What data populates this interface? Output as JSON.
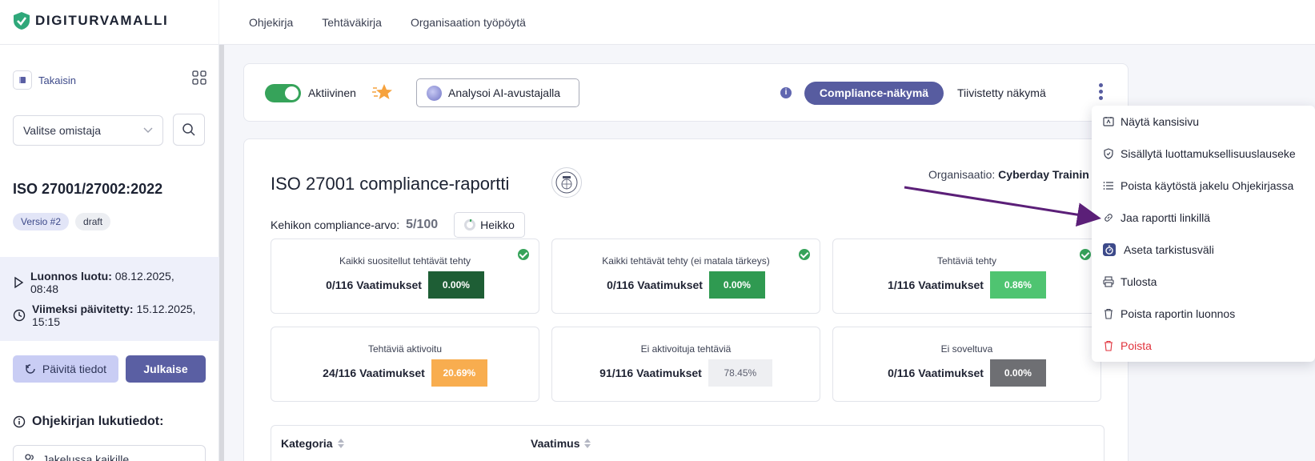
{
  "brand": {
    "name": "DIGITURVAMALLI"
  },
  "topnav": [
    "Ohjekirja",
    "Tehtäväkirja",
    "Organisaation työpöytä"
  ],
  "sidebar": {
    "back_label": "Takaisin",
    "owner_select": "Valitse omistaja",
    "doc_title": "ISO 27001/27002:2022",
    "version_badge": "Versio #2",
    "status_badge": "draft",
    "created_label": "Luonnos luotu:",
    "created_value": "08.12.2025,",
    "created_time": "08:48",
    "updated_label": "Viimeksi päivitetty:",
    "updated_value": "15.12.2025,",
    "updated_time": "15:15",
    "refresh_button": "Päivitä tiedot",
    "publish_button": "Julkaise",
    "reading_title": "Ohjekirjan lukutiedot:",
    "distribution_select": "Jakelussa kaikille"
  },
  "toolbar": {
    "active_label": "Aktiivinen",
    "ai_button": "Analysoi AI-avustajalla",
    "info_icon": "i",
    "compliance_view": "Compliance-näkymä",
    "compact_view": "Tiivistetty näkymä"
  },
  "report": {
    "title": "ISO 27001 compliance-raportti",
    "org_label": "Organisaatio:",
    "org_value": "Cyberday Trainin",
    "score_label": "Kehikon compliance-arvo:",
    "score_value": "5/100",
    "score_grade": "Heikko",
    "cards": [
      {
        "label": "Kaikki suositellut tehtävät tehty",
        "value": "0/116 Vaatimukset",
        "pct": "0.00%",
        "color": "#1e5e35",
        "checked": true
      },
      {
        "label": "Kaikki tehtävät tehty (ei matala tärkeys)",
        "value": "0/116 Vaatimukset",
        "pct": "0.00%",
        "color": "#2f9a51",
        "checked": true
      },
      {
        "label": "Tehtäviä tehty",
        "value": "1/116 Vaatimukset",
        "pct": "0.86%",
        "color": "#4fc471",
        "checked": true
      },
      {
        "label": "Tehtäviä aktivoitu",
        "value": "24/116 Vaatimukset",
        "pct": "20.69%",
        "color": "#f8ad4f",
        "checked": false
      },
      {
        "label": "Ei aktivoituja tehtäviä",
        "value": "91/116 Vaatimukset",
        "pct": "78.45%",
        "color": "#eeeff2",
        "checked": false
      },
      {
        "label": "Ei soveltuva",
        "value": "0/116 Vaatimukset",
        "pct": "0.00%",
        "color": "#6e6f73",
        "checked": false
      }
    ],
    "table_headers": [
      "Kategoria",
      "Vaatimus"
    ]
  },
  "menu": {
    "items": [
      {
        "label": "Näytä kansisivu",
        "icon": "cover-page-icon"
      },
      {
        "label": "Sisällytä luottamuksellisuuslauseke",
        "icon": "shield-icon"
      },
      {
        "label": "Poista käytöstä jakelu Ohjekirjassa",
        "icon": "list-icon"
      },
      {
        "label": "Jaa raportti linkillä",
        "icon": "link-icon"
      },
      {
        "label": "Aseta tarkistusväli",
        "icon": "timer-icon"
      },
      {
        "label": "Tulosta",
        "icon": "printer-icon"
      },
      {
        "label": "Poista raportin luonnos",
        "icon": "trash-icon"
      },
      {
        "label": "Poista",
        "icon": "trash-icon"
      }
    ]
  },
  "colors": {
    "accent": "#575ca0",
    "success": "#36a35a",
    "danger": "#e0313b",
    "annotation_arrow": "#5b1f78"
  }
}
